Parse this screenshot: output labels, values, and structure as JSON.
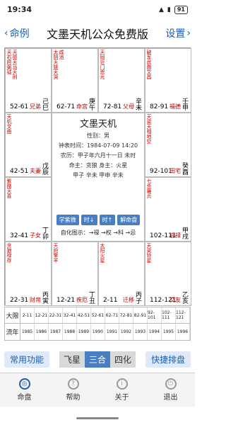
{
  "status": {
    "time": "19:34",
    "battery": "91"
  },
  "nav": {
    "back_label": "命例",
    "title": "文墨天机公众免费版",
    "settings_label": "设置"
  },
  "palaces": [
    {
      "stars": [
        "天右",
        "府弼",
        "钺",
        "天德",
        "天马",
        "天刑"
      ],
      "range": "52-61",
      "name": "兄弟",
      "stem": "己巳"
    },
    {
      "stars": [
        "太阴",
        "天姚",
        "天哭",
        "咸池"
      ],
      "range": "62-71",
      "name": "命宫",
      "stem": "庚午"
    },
    {
      "stars": [
        "天同",
        "巨门",
        "恩光"
      ],
      "range": "72-81",
      "name": "父母",
      "stem": "辛未"
    },
    {
      "stars": [
        "破军",
        "武曲",
        "文昌"
      ],
      "range": "82-91",
      "name": "福德",
      "stem": "壬申"
    },
    {
      "stars": [
        "天机",
        "文曲"
      ],
      "range": "42-51",
      "name": "夫妻",
      "stem": "戊辰"
    },
    {
      "stars": [
        "天梁",
        "天相",
        "地空"
      ],
      "range": "92-101",
      "name": "田宅",
      "stem": "癸酉"
    },
    {
      "stars": [
        "紫微",
        "天喜"
      ],
      "range": "32-41",
      "name": "子女",
      "stem": "丁卯"
    },
    {
      "stars": [
        "七杀",
        "廉贞"
      ],
      "range": "102-111",
      "name": "官禄",
      "stem": "甲戌"
    },
    {
      "stars": [
        "贪狼",
        "禄存"
      ],
      "range": "22-31",
      "name": "财帛",
      "stem": "丙寅"
    },
    {
      "stars": [
        "天府",
        "擎羊"
      ],
      "range": "12-21",
      "name": "疾厄",
      "stem": "丁丑"
    },
    {
      "stars": [
        "太阳",
        "火星"
      ],
      "range": "2-11",
      "name": "迁移",
      "stem": "丙子"
    },
    {
      "stars": [
        "天梁",
        "铃星"
      ],
      "range": "112-121",
      "name": "交友",
      "stem": "乙亥"
    }
  ],
  "center": {
    "title": "文墨天机",
    "gender_line": "性别：男",
    "solar": "钟表时间：1984-07-09 14:20",
    "lunar": "农历：甲子年六月十一日 未时",
    "bureau": "命主：贪狼 身主：火星",
    "pillars": "甲子 辛未 甲申 辛未",
    "buttons": [
      "学紫微",
      "时↓",
      "时↑",
      "解命盘"
    ],
    "legend": "自化图示：→禄 →权 →科 →忌"
  },
  "rows": {
    "daxian_label": "大限",
    "daxian": [
      "2-11",
      "12-21",
      "22-31",
      "32-41",
      "42-51",
      "52-61",
      "62-71",
      "72-81",
      "82-91",
      "92-101",
      "102-111",
      "112-121"
    ],
    "liunian_label": "流年",
    "liunian": [
      "1985",
      "1986",
      "1987",
      "1988",
      "1989",
      "1990",
      "1991",
      "1992",
      "1993",
      "1994",
      "1995",
      "1996"
    ]
  },
  "toolbar": {
    "common": "常用功能",
    "tabs": [
      "飞星",
      "三合",
      "四化"
    ],
    "quick": "快捷排盘"
  },
  "tabbar": {
    "items": [
      "命盘",
      "帮助",
      "关于",
      "退出"
    ]
  }
}
